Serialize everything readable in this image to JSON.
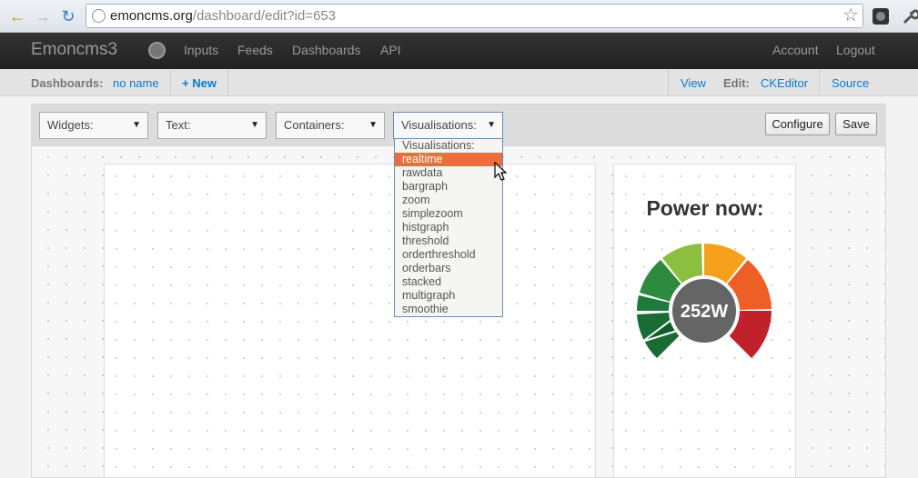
{
  "browser": {
    "url_host": "emoncms.org",
    "url_path": "/dashboard/edit?id=653"
  },
  "navbar": {
    "brand": "Emoncms3",
    "links": [
      "Inputs",
      "Feeds",
      "Dashboards",
      "API"
    ],
    "right_links": [
      "Account",
      "Logout"
    ]
  },
  "subbar": {
    "dashboards_label": "Dashboards:",
    "current_dashboard": "no name",
    "new_label": "+ New",
    "view_label": "View",
    "edit_label": "Edit:",
    "ckeditor_label": "CKEditor",
    "source_label": "Source"
  },
  "toolbar": {
    "widgets_select": "Widgets:",
    "text_select": "Text:",
    "containers_select": "Containers:",
    "visualisations_select": "Visualisations:",
    "configure_label": "Configure",
    "save_label": "Save"
  },
  "dropdown": {
    "items": [
      "Visualisations:",
      "realtime",
      "rawdata",
      "bargraph",
      "zoom",
      "simplezoom",
      "histgraph",
      "threshold",
      "orderthreshold",
      "orderbars",
      "stacked",
      "multigraph",
      "smoothie"
    ],
    "highlighted": "realtime"
  },
  "widget": {
    "title": "Power now:",
    "value_text": "252W",
    "gauge_colors": [
      "#1f7a3e",
      "#2e8b3e",
      "#8cbf3f",
      "#f5a11c",
      "#ee5f25",
      "#c0212a"
    ]
  }
}
